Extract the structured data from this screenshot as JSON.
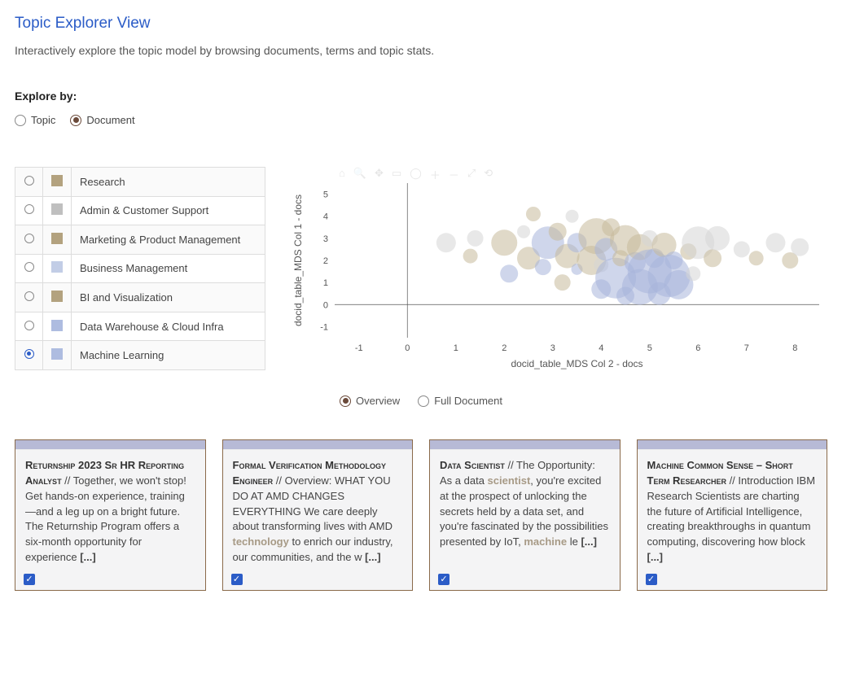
{
  "page": {
    "title": "Topic Explorer View",
    "subtitle": "Interactively explore the topic model by browsing documents, terms and topic stats."
  },
  "explore": {
    "label": "Explore by:",
    "options": [
      {
        "label": "Topic",
        "selected": false
      },
      {
        "label": "Document",
        "selected": true
      }
    ]
  },
  "topics": [
    {
      "label": "Research",
      "color": "#b3a27f",
      "selected": false
    },
    {
      "label": "Admin & Customer Support",
      "color": "#bfbfbf",
      "selected": false
    },
    {
      "label": "Marketing & Product Management",
      "color": "#b3a27f",
      "selected": false
    },
    {
      "label": "Business Management",
      "color": "#c2cde6",
      "selected": false
    },
    {
      "label": "BI and Visualization",
      "color": "#b3a27f",
      "selected": false
    },
    {
      "label": "Data Warehouse & Cloud Infra",
      "color": "#aebce0",
      "selected": false
    },
    {
      "label": "Machine Learning",
      "color": "#aebce0",
      "selected": true
    }
  ],
  "chart_data": {
    "type": "scatter",
    "xlabel": "docid_table_MDS Col 2 - docs",
    "ylabel": "docid_table_MDS Col 1 - docs",
    "xlim": [
      -1.5,
      8.5
    ],
    "ylim": [
      -1.5,
      5.5
    ],
    "xticks": [
      -1,
      0,
      1,
      2,
      3,
      4,
      5,
      6,
      7,
      8
    ],
    "yticks": [
      -1,
      0,
      1,
      2,
      3,
      4,
      5
    ],
    "colors": {
      "tan": "#c7b99a",
      "blue": "#a7b5da",
      "grey": "#d6d6d6"
    },
    "points": [
      {
        "x": 0.8,
        "y": 2.8,
        "r": 12,
        "c": "grey"
      },
      {
        "x": 1.4,
        "y": 3.0,
        "r": 10,
        "c": "grey"
      },
      {
        "x": 1.3,
        "y": 2.2,
        "r": 9,
        "c": "tan"
      },
      {
        "x": 2.0,
        "y": 2.8,
        "r": 16,
        "c": "tan"
      },
      {
        "x": 2.1,
        "y": 1.4,
        "r": 11,
        "c": "blue"
      },
      {
        "x": 2.4,
        "y": 3.3,
        "r": 8,
        "c": "grey"
      },
      {
        "x": 2.5,
        "y": 2.1,
        "r": 14,
        "c": "tan"
      },
      {
        "x": 2.6,
        "y": 4.1,
        "r": 9,
        "c": "tan"
      },
      {
        "x": 2.8,
        "y": 1.7,
        "r": 10,
        "c": "blue"
      },
      {
        "x": 2.9,
        "y": 2.8,
        "r": 20,
        "c": "blue"
      },
      {
        "x": 3.1,
        "y": 3.3,
        "r": 11,
        "c": "tan"
      },
      {
        "x": 3.2,
        "y": 1.0,
        "r": 10,
        "c": "tan"
      },
      {
        "x": 3.3,
        "y": 2.2,
        "r": 15,
        "c": "tan"
      },
      {
        "x": 3.4,
        "y": 4.0,
        "r": 8,
        "c": "grey"
      },
      {
        "x": 3.5,
        "y": 1.6,
        "r": 7,
        "c": "blue"
      },
      {
        "x": 3.5,
        "y": 2.8,
        "r": 12,
        "c": "blue"
      },
      {
        "x": 3.8,
        "y": 2.0,
        "r": 18,
        "c": "tan"
      },
      {
        "x": 3.9,
        "y": 3.1,
        "r": 22,
        "c": "tan"
      },
      {
        "x": 4.0,
        "y": 0.7,
        "r": 12,
        "c": "blue"
      },
      {
        "x": 4.0,
        "y": 1.8,
        "r": 9,
        "c": "grey"
      },
      {
        "x": 4.1,
        "y": 2.5,
        "r": 14,
        "c": "blue"
      },
      {
        "x": 4.2,
        "y": 3.5,
        "r": 11,
        "c": "tan"
      },
      {
        "x": 4.3,
        "y": 1.2,
        "r": 25,
        "c": "blue"
      },
      {
        "x": 4.4,
        "y": 2.1,
        "r": 10,
        "c": "tan"
      },
      {
        "x": 4.5,
        "y": 2.9,
        "r": 19,
        "c": "tan"
      },
      {
        "x": 4.5,
        "y": 0.4,
        "r": 11,
        "c": "blue"
      },
      {
        "x": 4.7,
        "y": 1.9,
        "r": 13,
        "c": "blue"
      },
      {
        "x": 4.8,
        "y": 2.6,
        "r": 16,
        "c": "tan"
      },
      {
        "x": 4.8,
        "y": 0.8,
        "r": 22,
        "c": "blue"
      },
      {
        "x": 5.0,
        "y": 1.5,
        "r": 27,
        "c": "blue"
      },
      {
        "x": 5.0,
        "y": 3.0,
        "r": 10,
        "c": "grey"
      },
      {
        "x": 5.1,
        "y": 2.1,
        "r": 12,
        "c": "blue"
      },
      {
        "x": 5.2,
        "y": 0.5,
        "r": 14,
        "c": "blue"
      },
      {
        "x": 5.3,
        "y": 2.7,
        "r": 15,
        "c": "tan"
      },
      {
        "x": 5.4,
        "y": 1.3,
        "r": 26,
        "c": "blue"
      },
      {
        "x": 5.5,
        "y": 2.0,
        "r": 11,
        "c": "blue"
      },
      {
        "x": 5.6,
        "y": 0.9,
        "r": 18,
        "c": "blue"
      },
      {
        "x": 5.8,
        "y": 2.4,
        "r": 10,
        "c": "tan"
      },
      {
        "x": 5.9,
        "y": 1.4,
        "r": 9,
        "c": "grey"
      },
      {
        "x": 6.0,
        "y": 2.8,
        "r": 20,
        "c": "grey"
      },
      {
        "x": 6.3,
        "y": 2.1,
        "r": 11,
        "c": "tan"
      },
      {
        "x": 6.4,
        "y": 3.0,
        "r": 15,
        "c": "grey"
      },
      {
        "x": 6.9,
        "y": 2.5,
        "r": 10,
        "c": "grey"
      },
      {
        "x": 7.2,
        "y": 2.1,
        "r": 9,
        "c": "tan"
      },
      {
        "x": 7.6,
        "y": 2.8,
        "r": 12,
        "c": "grey"
      },
      {
        "x": 7.9,
        "y": 2.0,
        "r": 10,
        "c": "tan"
      },
      {
        "x": 8.1,
        "y": 2.6,
        "r": 11,
        "c": "grey"
      }
    ]
  },
  "view_mode": {
    "options": [
      {
        "label": "Overview",
        "selected": true
      },
      {
        "label": "Full Document",
        "selected": false
      }
    ]
  },
  "cards": [
    {
      "title": "Returnship 2023 Sr HR Reporting Analyst",
      "body_pre": " // Together, we won't stop! Get hands-on experience, training—and a leg up on a bright future. The Returnship Program offers a six-month opportunity for experience ",
      "highlights": [],
      "body_post": "",
      "checked": true
    },
    {
      "title": "Formal Verification Methodology Engineer",
      "body_pre": " // Overview: WHAT YOU DO AT AMD CHANGES EVERYTHING We care deeply about transforming lives with AMD ",
      "highlights": [
        "technology"
      ],
      "body_post": " to enrich our industry, our communities, and the w ",
      "checked": true
    },
    {
      "title": "Data Scientist",
      "body_pre": " // The Opportunity: As a data ",
      "highlights": [
        "scientist"
      ],
      "body_mid1": ", you're excited at the prospect of unlocking the secrets held by a data set, and you're fascinated by the possibilities presented by IoT, ",
      "highlights2": [
        "machine"
      ],
      "body_post": " le ",
      "checked": true
    },
    {
      "title": "Machine Common Sense – Short Term Researcher",
      "body_pre": " // Introduction IBM Research Scientists are charting the future of Artificial Intelligence, creating breakthroughs in quantum computing, discovering how block ",
      "highlights": [],
      "body_post": "",
      "checked": true
    }
  ],
  "ellipsis": "[...]"
}
